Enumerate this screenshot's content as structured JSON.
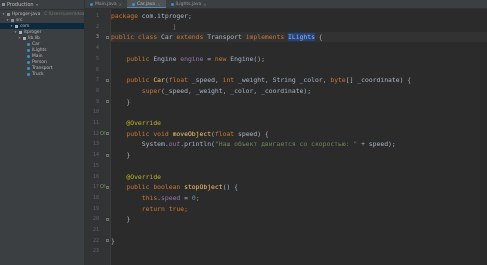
{
  "sidebar": {
    "title": "Production",
    "items": [
      {
        "text": "Hproger-java",
        "extra": "C:\\Users\\user\\IdeaProjects\\Hproger-java",
        "depth": 0,
        "icon": "folder",
        "open": true
      },
      {
        "text": "src",
        "depth": 1,
        "icon": "folder",
        "open": true
      },
      {
        "text": "com",
        "depth": 2,
        "icon": "package",
        "open": true
      },
      {
        "text": "itproger",
        "depth": 3,
        "icon": "package",
        "open": true
      },
      {
        "text": "lib.lib",
        "depth": 4,
        "icon": "package",
        "open": true
      },
      {
        "text": "Car",
        "depth": 5,
        "icon": "class"
      },
      {
        "text": "ILights",
        "depth": 5,
        "icon": "class"
      },
      {
        "text": "Main",
        "depth": 5,
        "icon": "class"
      },
      {
        "text": "Person",
        "depth": 5,
        "icon": "class"
      },
      {
        "text": "Transport",
        "depth": 5,
        "icon": "class"
      },
      {
        "text": "Truck",
        "depth": 5,
        "icon": "class"
      }
    ]
  },
  "tabs": [
    {
      "label": "Main.java",
      "active": false
    },
    {
      "label": "Car.java",
      "active": true
    },
    {
      "label": "ILights.java",
      "active": false
    }
  ],
  "editor": {
    "current_line": 3,
    "lines": [
      {
        "n": 1,
        "tokens": [
          {
            "t": "package ",
            "c": "kw"
          },
          {
            "t": "com.itproger;",
            "c": ""
          }
        ]
      },
      {
        "n": 2,
        "tokens": [
          {
            "t": "                ",
            "c": ""
          },
          {
            "t": "]",
            "c": "muted"
          }
        ]
      },
      {
        "n": 3,
        "tokens": [
          {
            "t": "public class ",
            "c": "kw"
          },
          {
            "t": "Car ",
            "c": "cls"
          },
          {
            "t": "extends ",
            "c": "kw"
          },
          {
            "t": "Transport ",
            "c": ""
          },
          {
            "t": "implements ",
            "c": "kw"
          },
          {
            "t": "ILights",
            "c": "sel"
          },
          {
            "t": " {",
            "c": ""
          }
        ]
      },
      {
        "n": 4,
        "tokens": []
      },
      {
        "n": 5,
        "tokens": [
          {
            "t": "    public ",
            "c": "kw"
          },
          {
            "t": "Engine ",
            "c": ""
          },
          {
            "t": "engine",
            "c": "fld"
          },
          {
            "t": " = ",
            "c": ""
          },
          {
            "t": "new ",
            "c": "kw"
          },
          {
            "t": "Engine();",
            "c": ""
          }
        ]
      },
      {
        "n": 6,
        "tokens": []
      },
      {
        "n": 7,
        "tokens": [
          {
            "t": "    public ",
            "c": "kw"
          },
          {
            "t": "Car",
            "c": "fn"
          },
          {
            "t": "(",
            "c": ""
          },
          {
            "t": "float ",
            "c": "kw"
          },
          {
            "t": "_speed, ",
            "c": ""
          },
          {
            "t": "int ",
            "c": "kw"
          },
          {
            "t": "_weight, String _color, ",
            "c": ""
          },
          {
            "t": "byte",
            "c": "kw"
          },
          {
            "t": "[] _coordinate) {",
            "c": ""
          }
        ]
      },
      {
        "n": 8,
        "tokens": [
          {
            "t": "        super",
            "c": "kw"
          },
          {
            "t": "(_speed, _weight, _color, _coordinate);",
            "c": ""
          }
        ]
      },
      {
        "n": 9,
        "tokens": [
          {
            "t": "    }",
            "c": ""
          }
        ]
      },
      {
        "n": 10,
        "tokens": []
      },
      {
        "n": 11,
        "tokens": [
          {
            "t": "    @Override",
            "c": "ann"
          }
        ]
      },
      {
        "n": 12,
        "gutter": "O!",
        "tokens": [
          {
            "t": "    public void ",
            "c": "kw"
          },
          {
            "t": "moveObject",
            "c": "fn"
          },
          {
            "t": "(",
            "c": ""
          },
          {
            "t": "float ",
            "c": "kw"
          },
          {
            "t": "speed) {",
            "c": ""
          }
        ]
      },
      {
        "n": 13,
        "tokens": [
          {
            "t": "        System.",
            "c": ""
          },
          {
            "t": "out",
            "c": "fldi"
          },
          {
            "t": ".println(",
            "c": ""
          },
          {
            "t": "\"Наш объект двигается со скоростью: \"",
            "c": "str"
          },
          {
            "t": " + speed);",
            "c": ""
          }
        ]
      },
      {
        "n": 14,
        "tokens": [
          {
            "t": "    }",
            "c": ""
          }
        ]
      },
      {
        "n": 15,
        "tokens": []
      },
      {
        "n": 16,
        "tokens": [
          {
            "t": "    @Override",
            "c": "ann"
          }
        ]
      },
      {
        "n": 17,
        "gutter": "O!",
        "tokens": [
          {
            "t": "    public boolean ",
            "c": "kw"
          },
          {
            "t": "stopObject",
            "c": "fn"
          },
          {
            "t": "() {",
            "c": ""
          }
        ]
      },
      {
        "n": 18,
        "tokens": [
          {
            "t": "        this",
            "c": "kw"
          },
          {
            "t": ".",
            "c": ""
          },
          {
            "t": "speed",
            "c": "fld"
          },
          {
            "t": " = ",
            "c": ""
          },
          {
            "t": "0",
            "c": "num"
          },
          {
            "t": ";",
            "c": "kw"
          }
        ]
      },
      {
        "n": 19,
        "tokens": [
          {
            "t": "        return true",
            "c": "kw"
          },
          {
            "t": ";",
            "c": "kw"
          }
        ]
      },
      {
        "n": 20,
        "tokens": [
          {
            "t": "    }",
            "c": ""
          }
        ]
      },
      {
        "n": 21,
        "tokens": []
      },
      {
        "n": 22,
        "tokens": [
          {
            "t": "}",
            "c": ""
          }
        ]
      },
      {
        "n": 23,
        "tokens": []
      }
    ]
  }
}
